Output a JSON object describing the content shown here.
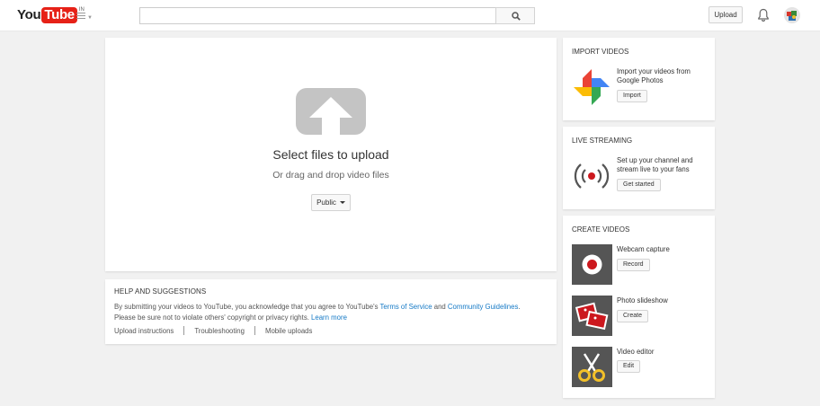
{
  "header": {
    "logo_you": "You",
    "logo_tube": "Tube",
    "logo_country": "IN",
    "search_value": "",
    "upload_label": "Upload"
  },
  "upload": {
    "select_files": "Select files to upload",
    "drag_drop": "Or drag and drop video files",
    "privacy_value": "Public"
  },
  "help": {
    "title": "HELP AND SUGGESTIONS",
    "text_1": "By submitting your videos to YouTube, you acknowledge that you agree to YouTube's ",
    "tos_link": "Terms of Service",
    "text_and": " and ",
    "guidelines_link": "Community Guidelines",
    "text_2": ".",
    "text_3": "Please be sure not to violate others' copyright or privacy rights. ",
    "learn_more": "Learn more",
    "links": [
      "Upload instructions",
      "Troubleshooting",
      "Mobile uploads"
    ]
  },
  "import_videos": {
    "title": "IMPORT VIDEOS",
    "text_line1": "Import your videos from",
    "text_line2": "Google Photos",
    "button": "Import"
  },
  "live_streaming": {
    "title": "LIVE STREAMING",
    "text_line1": "Set up your channel and",
    "text_line2": "stream live to your fans",
    "button": "Get started"
  },
  "create_videos": {
    "title": "CREATE VIDEOS",
    "items": [
      {
        "label": "Webcam capture",
        "button": "Record",
        "icon": "record-icon"
      },
      {
        "label": "Photo slideshow",
        "button": "Create",
        "icon": "slideshow-icon"
      },
      {
        "label": "Video editor",
        "button": "Edit",
        "icon": "scissors-icon"
      }
    ]
  },
  "colors": {
    "brand_red": "#e62117",
    "link_blue": "#167ac6",
    "background": "#f1f1f1"
  }
}
